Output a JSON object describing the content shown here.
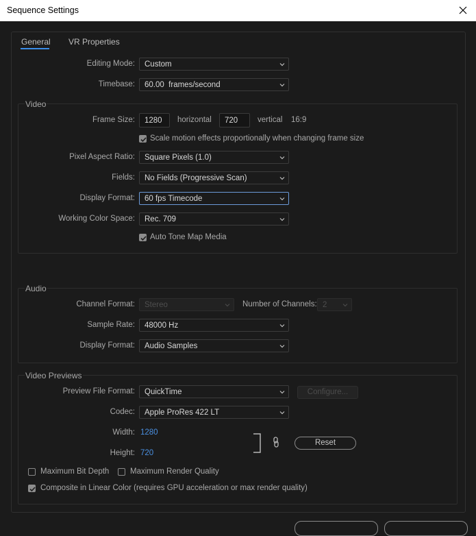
{
  "window": {
    "title": "Sequence Settings"
  },
  "tabs": [
    {
      "label": "General"
    },
    {
      "label": "VR Properties"
    }
  ],
  "general": {
    "editing_mode": {
      "label": "Editing Mode:",
      "value": "Custom"
    },
    "timebase": {
      "label": "Timebase:",
      "value": "60.00  frames/second"
    }
  },
  "video": {
    "title": "Video",
    "frame_size": {
      "label": "Frame Size:",
      "width": "1280",
      "horizontal": "horizontal",
      "height": "720",
      "vertical": "vertical",
      "ratio": "16:9"
    },
    "scale_motion": {
      "label": "Scale motion effects proportionally when changing frame size",
      "checked": true
    },
    "pixel_aspect": {
      "label": "Pixel Aspect Ratio:",
      "value": "Square Pixels (1.0)"
    },
    "fields": {
      "label": "Fields:",
      "value": "No Fields (Progressive Scan)"
    },
    "display_format": {
      "label": "Display Format:",
      "value": "60 fps Timecode"
    },
    "color_space": {
      "label": "Working Color Space:",
      "value": "Rec. 709"
    },
    "auto_tone": {
      "label": "Auto Tone Map Media",
      "checked": true
    }
  },
  "audio": {
    "title": "Audio",
    "channel_format": {
      "label": "Channel Format:",
      "value": "Stereo"
    },
    "num_channels": {
      "label": "Number of Channels:",
      "value": "2"
    },
    "sample_rate": {
      "label": "Sample Rate:",
      "value": "48000 Hz"
    },
    "display_format": {
      "label": "Display Format:",
      "value": "Audio Samples"
    }
  },
  "previews": {
    "title": "Video Previews",
    "file_format": {
      "label": "Preview File Format:",
      "value": "QuickTime"
    },
    "configure": "Configure...",
    "codec": {
      "label": "Codec:",
      "value": "Apple ProRes 422 LT"
    },
    "width": {
      "label": "Width:",
      "value": "1280"
    },
    "height": {
      "label": "Height:",
      "value": "720"
    },
    "reset": "Reset",
    "max_bit_depth": {
      "label": "Maximum Bit Depth",
      "checked": false
    },
    "max_render_quality": {
      "label": "Maximum Render Quality",
      "checked": false
    },
    "linear_color": {
      "label": "Composite in Linear Color (requires GPU acceleration or max render quality)",
      "checked": true
    }
  },
  "colors": {
    "accent": "#3b8eea",
    "link": "#4a8fe0",
    "background": "#1b1b1b"
  },
  "icons": [
    "close-icon",
    "chevron-down-icon",
    "checkmark-icon",
    "chain-link-icon"
  ]
}
